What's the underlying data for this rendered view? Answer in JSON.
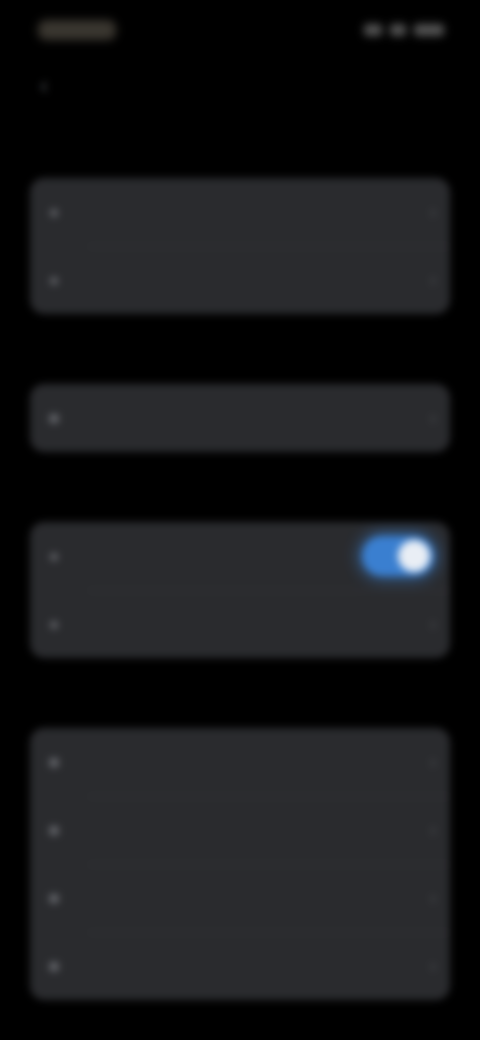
{
  "status_bar": {
    "time": "",
    "icons": [
      "signal-icon",
      "wifi-icon",
      "battery-icon"
    ]
  },
  "nav": {
    "back_icon": "chevron-left-icon",
    "title": ""
  },
  "sections": [
    {
      "header": "",
      "rows": [
        {
          "icon": "circle-icon",
          "label": "",
          "control": "chevron"
        },
        {
          "icon": "circle-icon",
          "label": "",
          "control": "chevron"
        }
      ]
    },
    {
      "header": "",
      "rows": [
        {
          "icon": "square-icon",
          "label": "",
          "value": "",
          "control": "chevron"
        }
      ]
    },
    {
      "header": "",
      "rows": [
        {
          "icon": "circle-icon",
          "label": "",
          "control": "toggle",
          "toggle_on": true
        },
        {
          "icon": "circle-icon",
          "label": "",
          "control": "chevron"
        }
      ]
    },
    {
      "header": "",
      "rows": [
        {
          "icon": "square-icon",
          "label": "",
          "control": "chevron"
        },
        {
          "icon": "square-icon",
          "label": "",
          "control": "chevron"
        },
        {
          "icon": "square-icon",
          "label": "",
          "control": "chevron"
        },
        {
          "icon": "square-icon",
          "label": "",
          "control": "chevron"
        }
      ]
    }
  ],
  "colors": {
    "background": "#000000",
    "card": "#2a2b2e",
    "accent": "#3a7fd0"
  }
}
